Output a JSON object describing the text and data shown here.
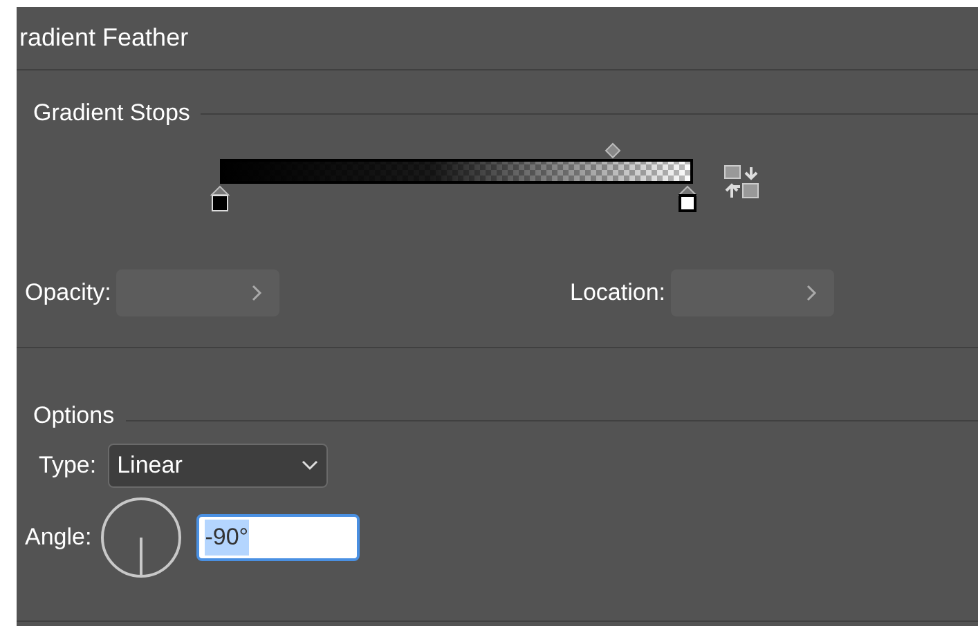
{
  "panel": {
    "title": "radient Feather"
  },
  "gradient_stops": {
    "heading": "Gradient Stops",
    "stops": [
      {
        "color": "#000000"
      },
      {
        "color": "#ffffff"
      }
    ],
    "opacity": {
      "label": "Opacity:",
      "disabled": true
    },
    "location": {
      "label": "Location:",
      "disabled": true
    }
  },
  "options": {
    "heading": "Options",
    "type": {
      "label": "Type:",
      "value": "Linear"
    },
    "angle": {
      "label": "Angle:",
      "value": "-90°",
      "text_selected": true
    }
  }
}
